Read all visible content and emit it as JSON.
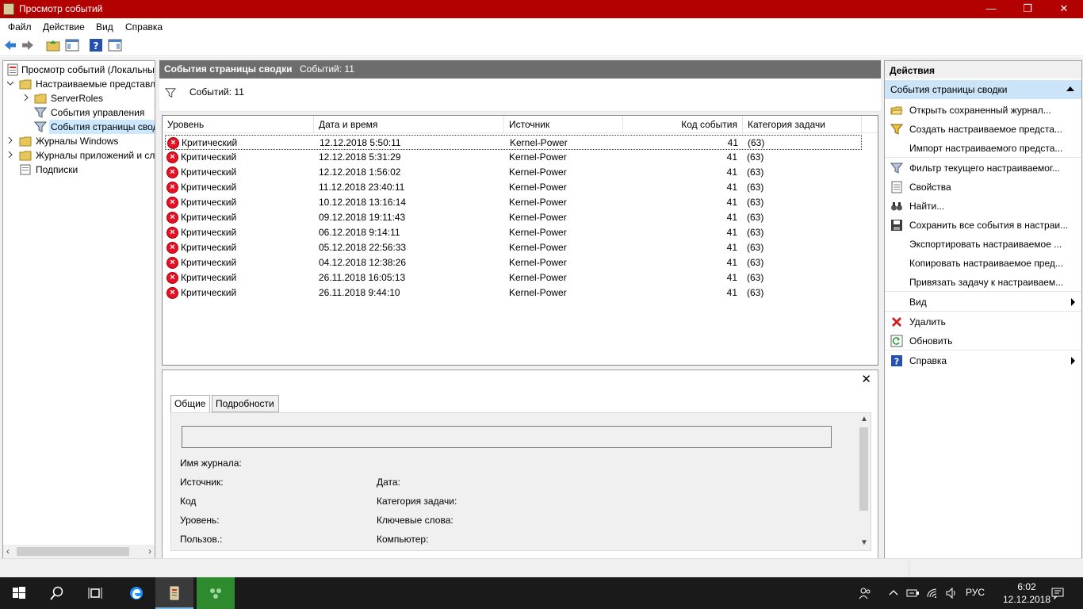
{
  "window": {
    "title": "Просмотр событий",
    "minimize": "—",
    "maximize": "❐",
    "close": "✕"
  },
  "menu": [
    "Файл",
    "Действие",
    "Вид",
    "Справка"
  ],
  "tree": [
    {
      "label": "Просмотр событий (Локальны",
      "icon": "event-viewer-icon"
    },
    {
      "label": "Настраиваемые представле",
      "icon": "folder-icon"
    },
    {
      "label": "ServerRoles",
      "icon": "folder-icon"
    },
    {
      "label": "События управления",
      "icon": "filter-icon"
    },
    {
      "label": "События страницы свод",
      "icon": "filter-icon"
    },
    {
      "label": "Журналы Windows",
      "icon": "folder-icon"
    },
    {
      "label": "Журналы приложений и сл",
      "icon": "folder-icon"
    },
    {
      "label": "Подписки",
      "icon": "subscription-icon"
    }
  ],
  "center": {
    "header_title": "События страницы сводки",
    "header_count": "Событий: 11",
    "filter_text": "Событий: 11"
  },
  "events": {
    "columns": [
      "Уровень",
      "Дата и время",
      "Источник",
      "Код события",
      "Категория задачи"
    ],
    "rows": [
      {
        "level": "Критический",
        "datetime": "12.12.2018 5:50:11",
        "source": "Kernel-Power",
        "code": "41",
        "category": "(63)"
      },
      {
        "level": "Критический",
        "datetime": "12.12.2018 5:31:29",
        "source": "Kernel-Power",
        "code": "41",
        "category": "(63)"
      },
      {
        "level": "Критический",
        "datetime": "12.12.2018 1:56:02",
        "source": "Kernel-Power",
        "code": "41",
        "category": "(63)"
      },
      {
        "level": "Критический",
        "datetime": "11.12.2018 23:40:11",
        "source": "Kernel-Power",
        "code": "41",
        "category": "(63)"
      },
      {
        "level": "Критический",
        "datetime": "10.12.2018 13:16:14",
        "source": "Kernel-Power",
        "code": "41",
        "category": "(63)"
      },
      {
        "level": "Критический",
        "datetime": "09.12.2018 19:11:43",
        "source": "Kernel-Power",
        "code": "41",
        "category": "(63)"
      },
      {
        "level": "Критический",
        "datetime": "06.12.2018 9:14:11",
        "source": "Kernel-Power",
        "code": "41",
        "category": "(63)"
      },
      {
        "level": "Критический",
        "datetime": "05.12.2018 22:56:33",
        "source": "Kernel-Power",
        "code": "41",
        "category": "(63)"
      },
      {
        "level": "Критический",
        "datetime": "04.12.2018 12:38:26",
        "source": "Kernel-Power",
        "code": "41",
        "category": "(63)"
      },
      {
        "level": "Критический",
        "datetime": "26.11.2018 16:05:13",
        "source": "Kernel-Power",
        "code": "41",
        "category": "(63)"
      },
      {
        "level": "Критический",
        "datetime": "26.11.2018 9:44:10",
        "source": "Kernel-Power",
        "code": "41",
        "category": "(63)"
      }
    ]
  },
  "details": {
    "tabs": [
      "Общие",
      "Подробности"
    ],
    "close": "✕",
    "fields": {
      "log_name": "Имя журнала:",
      "source": "Источник:",
      "date": "Дата:",
      "code": "Код",
      "task_category": "Категория задачи:",
      "level": "Уровень:",
      "keywords": "Ключевые слова:",
      "user": "Пользов.:",
      "computer": "Компьютер:"
    }
  },
  "actions": {
    "header": "Действия",
    "section": "События страницы сводки",
    "items": [
      {
        "label": "Открыть сохраненный журнал...",
        "icon": "open-folder-icon"
      },
      {
        "label": "Создать настраиваемое предста...",
        "icon": "create-filter-icon"
      },
      {
        "label": "Импорт настраиваемого предста...",
        "icon": ""
      },
      {
        "label": "Фильтр текущего настраиваемог...",
        "icon": "filter-icon"
      },
      {
        "label": "Свойства",
        "icon": "properties-icon"
      },
      {
        "label": "Найти...",
        "icon": "binoculars-icon"
      },
      {
        "label": "Сохранить все события в настраи...",
        "icon": "save-icon"
      },
      {
        "label": "Экспортировать настраиваемое ...",
        "icon": ""
      },
      {
        "label": "Копировать настраиваемое пред...",
        "icon": ""
      },
      {
        "label": "Привязать задачу к настраиваем...",
        "icon": ""
      },
      {
        "label": "Вид",
        "icon": ""
      },
      {
        "label": "Удалить",
        "icon": "delete-icon"
      },
      {
        "label": "Обновить",
        "icon": "refresh-icon"
      },
      {
        "label": "Справка",
        "icon": "help-icon"
      }
    ]
  },
  "taskbar": {
    "language": "РУС",
    "time": "6:02",
    "date": "12.12.2018"
  },
  "colors": {
    "titlebar": "#b30000",
    "selection": "#cce8ff",
    "action_section": "#cce4f7",
    "error": "#e81123"
  }
}
